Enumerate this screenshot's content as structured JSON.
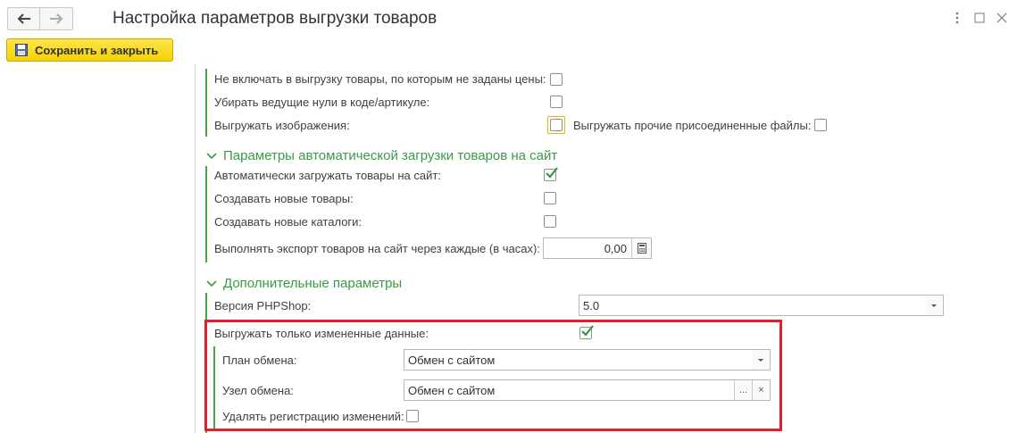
{
  "window": {
    "title": "Настройка параметров выгрузки товаров"
  },
  "toolbar": {
    "save_close_label": "Сохранить и закрыть"
  },
  "general": {
    "no_price_label": "Не включать в выгрузку товары, по которым не заданы цены:",
    "no_price_checked": false,
    "strip_zeros_label": "Убирать ведущие нули в коде/артикуле:",
    "strip_zeros_checked": false,
    "export_images_label": "Выгружать изображения:",
    "export_images_checked": false,
    "export_other_files_label": "Выгружать прочие присоединенные файлы:",
    "export_other_files_checked": false
  },
  "auto_upload": {
    "header": "Параметры автоматической загрузки товаров на сайт",
    "auto_upload_label": "Автоматически загружать товары на сайт:",
    "auto_upload_checked": true,
    "create_goods_label": "Создавать новые товары:",
    "create_goods_checked": false,
    "create_catalogs_label": "Создавать новые каталоги:",
    "create_catalogs_checked": false,
    "interval_label": "Выполнять экспорт товаров на сайт через каждые (в часах):",
    "interval_value": "0,00"
  },
  "extra": {
    "header": "Дополнительные параметры",
    "version_label": "Версия PHPShop:",
    "version_value": "5.0",
    "changed_only_label": "Выгружать только измененные данные:",
    "changed_only_checked": true,
    "exchange_plan_label": "План обмена:",
    "exchange_plan_value": "Обмен с сайтом",
    "exchange_node_label": "Узел обмена:",
    "exchange_node_value": "Обмен с сайтом",
    "node_select_glyph": "...",
    "node_clear_glyph": "×",
    "delete_reg_label": "Удалять регистрацию изменений:",
    "delete_reg_checked": false
  },
  "colors": {
    "accent_green": "#3a9a48",
    "highlight_red": "#e2202b",
    "save_yellow": "#f5d100"
  },
  "icons": [
    "back-arrow-icon",
    "forward-arrow-icon",
    "more-vertical-icon",
    "maximize-icon",
    "close-icon",
    "floppy-disk-icon",
    "chevron-down-icon",
    "checkmark-icon",
    "calculator-icon",
    "dropdown-arrow-icon"
  ]
}
